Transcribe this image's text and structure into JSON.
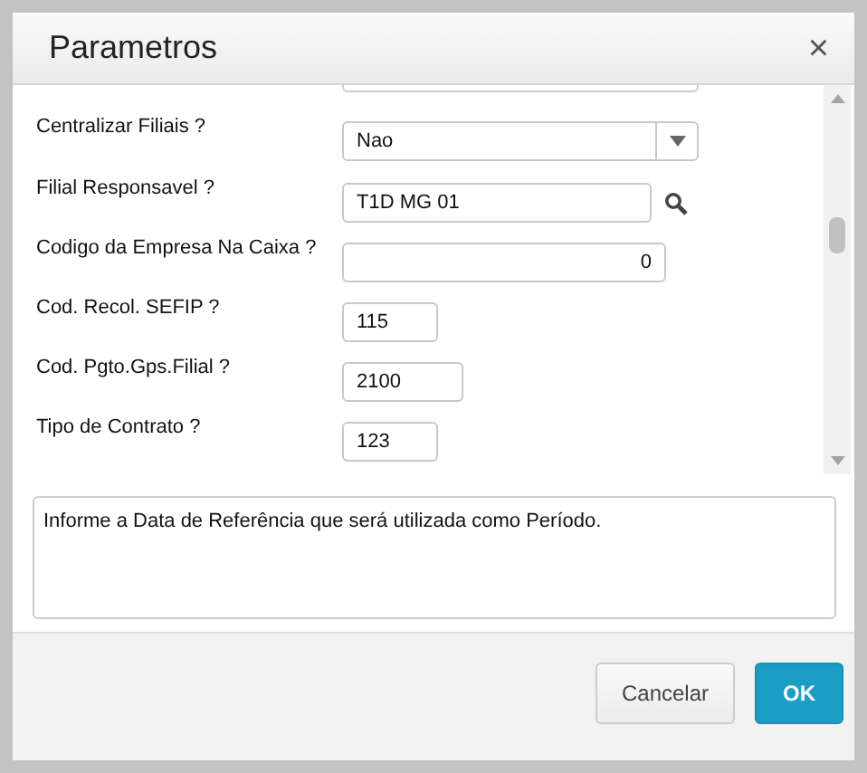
{
  "dialog": {
    "title": "Parametros",
    "close": "×"
  },
  "fields": [
    {
      "label": "Centralizar Filiais ?",
      "kind": "select",
      "value": "Nao"
    },
    {
      "label": "Filial Responsavel ?",
      "kind": "lookup",
      "value": "T1D MG 01"
    },
    {
      "label": "Codigo da Empresa Na Caixa ?",
      "kind": "number",
      "value": "0"
    },
    {
      "label": "Cod. Recol. SEFIP ?",
      "kind": "text",
      "value": "115"
    },
    {
      "label": "Cod. Pgto.Gps.Filial ?",
      "kind": "text",
      "value": "2100"
    },
    {
      "label": "Tipo de Contrato ?",
      "kind": "text",
      "value": "123"
    }
  ],
  "help_text": "Informe a Data de Referência que será utilizada como Período.",
  "buttons": [
    {
      "label": "Cancelar",
      "kind": "secondary"
    },
    {
      "label": "OK",
      "kind": "primary"
    }
  ]
}
